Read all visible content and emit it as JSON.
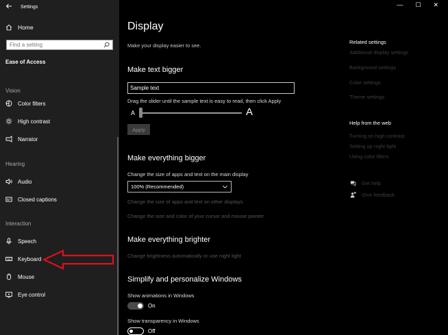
{
  "titlebar": {
    "app_title": "Settings",
    "minimize_glyph": "—",
    "maximize_glyph": "☐",
    "close_glyph": "✕"
  },
  "sidebar": {
    "home_label": "Home",
    "search_placeholder": "Find a setting",
    "section_title": "Ease of Access",
    "groups": [
      {
        "label": "Vision",
        "items": [
          {
            "label": "Color filters",
            "icon": "color-filters-icon"
          },
          {
            "label": "High contrast",
            "icon": "high-contrast-icon"
          },
          {
            "label": "Narrator",
            "icon": "narrator-icon"
          }
        ]
      },
      {
        "label": "Hearing",
        "items": [
          {
            "label": "Audio",
            "icon": "speaker-icon"
          },
          {
            "label": "Closed captions",
            "icon": "captions-icon"
          }
        ]
      },
      {
        "label": "Interaction",
        "items": [
          {
            "label": "Speech",
            "icon": "microphone-icon"
          },
          {
            "label": "Keyboard",
            "icon": "keyboard-icon"
          },
          {
            "label": "Mouse",
            "icon": "mouse-icon"
          },
          {
            "label": "Eye control",
            "icon": "eye-control-icon"
          }
        ]
      }
    ]
  },
  "main": {
    "title": "Display",
    "subtitle": "Make your display easier to see.",
    "text_bigger": {
      "heading": "Make text bigger",
      "sample_value": "Sample text",
      "instruction": "Drag the slider until the sample text is easy to read, then click Apply",
      "slider_small_label": "A",
      "slider_large_label": "A",
      "slider_level": 0,
      "apply_label": "Apply"
    },
    "everything_bigger": {
      "heading": "Make everything bigger",
      "label": "Change the size of apps and text on the main display",
      "selected_option": "100% (Recommended)",
      "link_other_displays": "Change the size of apps and text on other displays",
      "link_cursor": "Change the size and color of your cursor and mouse pointer"
    },
    "everything_brighter": {
      "heading": "Make everything brighter",
      "link": "Change brightness automatically or use night light"
    },
    "simplify": {
      "heading": "Simplify and personalize Windows",
      "animations_label": "Show animations in Windows",
      "animations_state": "On",
      "transparency_label": "Show transparency in Windows",
      "transparency_state": "Off"
    }
  },
  "related": {
    "heading": "Related settings",
    "links": [
      "Additional display settings",
      "Background settings",
      "Color settings",
      "Theme settings"
    ]
  },
  "help": {
    "heading": "Help from the web",
    "links": [
      "Turning on high contrast",
      "Setting up night light",
      "Using color filters"
    ],
    "get_help": "Get help",
    "give_feedback": "Give feedback"
  },
  "colors": {
    "annotation_arrow": "#e0101a",
    "background": "#000000",
    "sidebar": "#1f1f1f"
  }
}
